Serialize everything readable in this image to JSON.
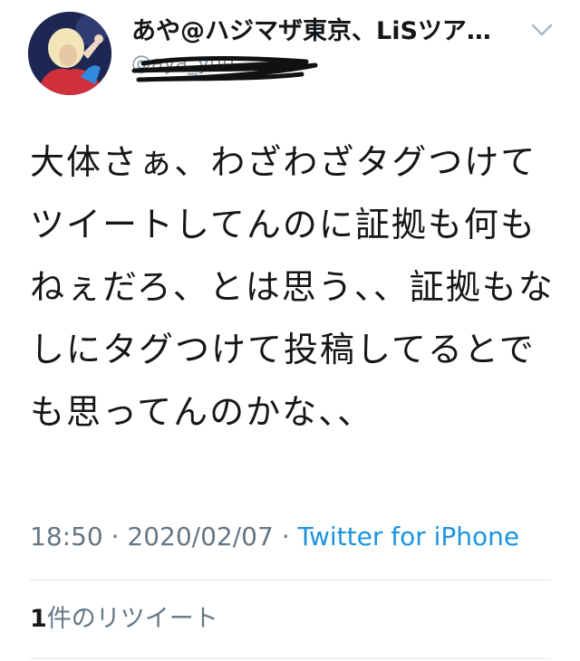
{
  "user": {
    "display_name": "あや@ハジマザ東京、LiSツア…",
    "handle": "@aya_yuu"
  },
  "tweet": {
    "text": "大体さぁ、わざわざタグつけてツイートしてんのに証拠も何もねぇだろ、とは思う、、証拠もなしにタグつけて投稿してるとでも思ってんのかな、、"
  },
  "meta": {
    "time": "18:50",
    "sep1": " · ",
    "date": "2020/02/07",
    "sep2": " · ",
    "source": "Twitter for iPhone"
  },
  "stats": {
    "retweet_count": "1",
    "retweet_label": "件のリツイート"
  },
  "colors": {
    "text": "#14171a",
    "muted": "#657786",
    "link": "#1b95e0",
    "divider": "#e1e8ed"
  },
  "icons": [
    "chevron-down-icon",
    "avatar"
  ]
}
